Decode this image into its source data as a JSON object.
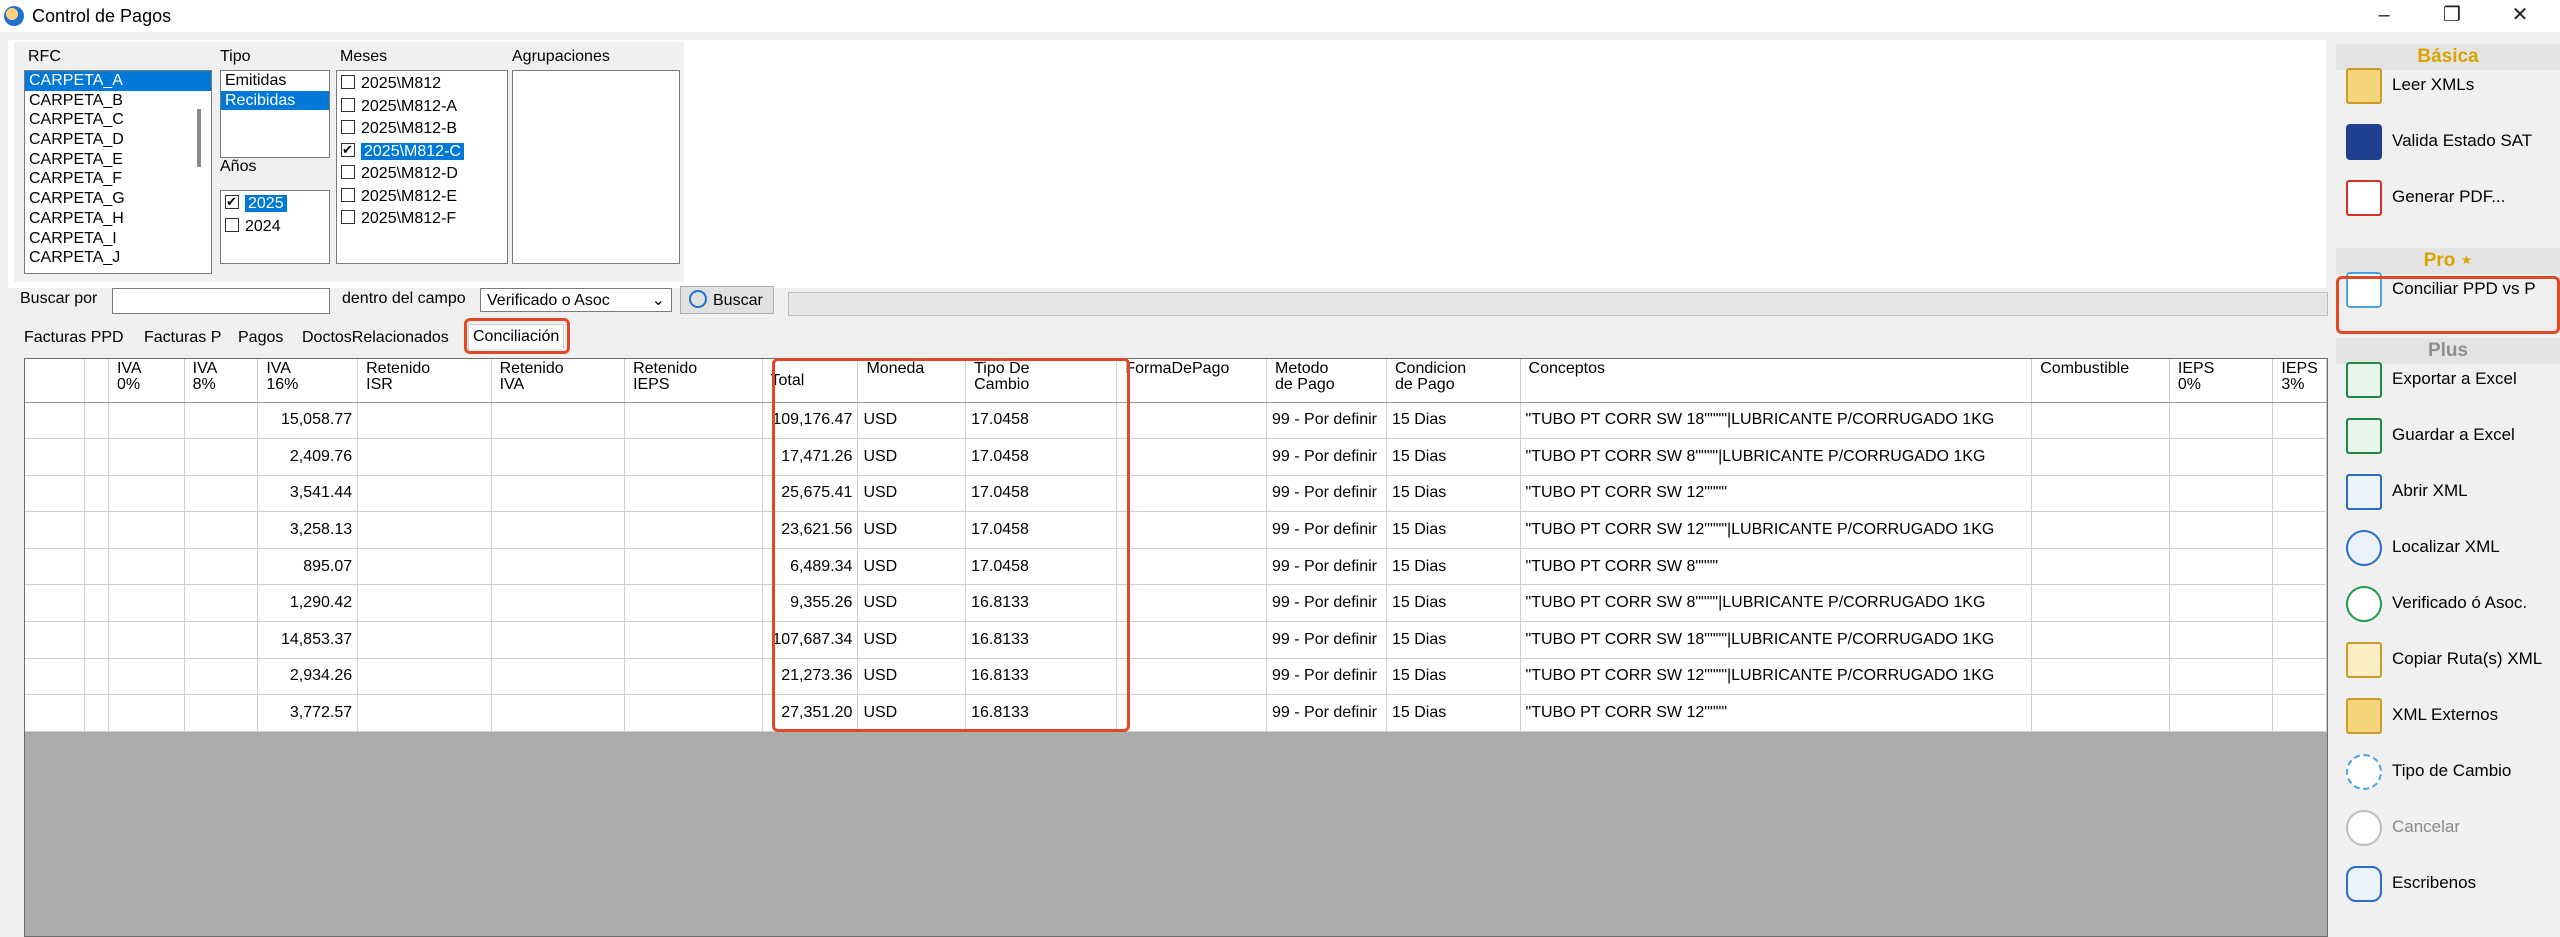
{
  "window": {
    "title": "Control de Pagos"
  },
  "filters": {
    "rfc": {
      "label": "RFC",
      "items": [
        "CARPETA_A",
        "CARPETA_B",
        "CARPETA_C",
        "CARPETA_D",
        "CARPETA_E",
        "CARPETA_F",
        "CARPETA_G",
        "CARPETA_H",
        "CARPETA_I",
        "CARPETA_J"
      ],
      "selected": "CARPETA_A"
    },
    "tipo": {
      "label": "Tipo",
      "items": [
        "Emitidas",
        "Recibidas"
      ],
      "selected": "Recibidas"
    },
    "anios": {
      "label": "Años",
      "items": [
        {
          "label": "2025",
          "checked": true
        },
        {
          "label": "2024",
          "checked": false
        }
      ]
    },
    "meses": {
      "label": "Meses",
      "items": [
        {
          "label": "2025\\M812",
          "checked": false
        },
        {
          "label": "2025\\M812-A",
          "checked": false
        },
        {
          "label": "2025\\M812-B",
          "checked": false
        },
        {
          "label": "2025\\M812-C",
          "checked": true
        },
        {
          "label": "2025\\M812-D",
          "checked": false
        },
        {
          "label": "2025\\M812-E",
          "checked": false
        },
        {
          "label": "2025\\M812-F",
          "checked": false
        }
      ]
    },
    "agrupaciones": {
      "label": "Agrupaciones"
    }
  },
  "search": {
    "label": "Buscar por",
    "value": "",
    "field_label": "dentro del campo",
    "field_value": "Verificado o Asoc",
    "button": "Buscar"
  },
  "tabs": [
    "Facturas PPD",
    "Facturas P",
    "Pagos",
    "DoctosRelacionados",
    "Conciliación"
  ],
  "active_tab": "Conciliación",
  "grid": {
    "columns": [
      "",
      "",
      "IVA\n0%",
      "IVA\n8%",
      "IVA\n16%",
      "Retenido\nISR",
      "Retenido\nIVA",
      "Retenido\nIEPS",
      "Total",
      "Moneda",
      "Tipo De\nCambio",
      "FormaDePago",
      "Metodo\nde Pago",
      "Condicion\nde Pago",
      "Conceptos",
      "Combustible",
      "IEPS\n0%",
      "IEPS\n3%"
    ],
    "rows": [
      {
        "iva16": "15,058.77",
        "total": "109,176.47",
        "moneda": "USD",
        "tc": "17.0458",
        "metodo": "99 - Por definir",
        "condicion": "15 Dias",
        "conceptos": "\"TUBO PT CORR  SW 18\"\"\"\"|LUBRICANTE P/CORRUGADO 1KG"
      },
      {
        "iva16": "2,409.76",
        "total": "17,471.26",
        "moneda": "USD",
        "tc": "17.0458",
        "metodo": "99 - Por definir",
        "condicion": "15 Dias",
        "conceptos": "\"TUBO PT CORR  SW 8\"\"\"\"|LUBRICANTE P/CORRUGADO 1KG"
      },
      {
        "iva16": "3,541.44",
        "total": "25,675.41",
        "moneda": "USD",
        "tc": "17.0458",
        "metodo": "99 - Por definir",
        "condicion": "15 Dias",
        "conceptos": "\"TUBO PT CORR  SW 12\"\"\"\""
      },
      {
        "iva16": "3,258.13",
        "total": "23,621.56",
        "moneda": "USD",
        "tc": "17.0458",
        "metodo": "99 - Por definir",
        "condicion": "15 Dias",
        "conceptos": "\"TUBO PT CORR  SW 12\"\"\"\"|LUBRICANTE P/CORRUGADO 1KG"
      },
      {
        "iva16": "895.07",
        "total": "6,489.34",
        "moneda": "USD",
        "tc": "17.0458",
        "metodo": "99 - Por definir",
        "condicion": "15 Dias",
        "conceptos": "\"TUBO PT CORR  SW 8\"\"\"\""
      },
      {
        "iva16": "1,290.42",
        "total": "9,355.26",
        "moneda": "USD",
        "tc": "16.8133",
        "metodo": "99 - Por definir",
        "condicion": "15 Dias",
        "conceptos": "\"TUBO PT CORR  SW 8\"\"\"\"|LUBRICANTE P/CORRUGADO 1KG"
      },
      {
        "iva16": "14,853.37",
        "total": "107,687.34",
        "moneda": "USD",
        "tc": "16.8133",
        "metodo": "99 - Por definir",
        "condicion": "15 Dias",
        "conceptos": "\"TUBO PT CORR  SW 18\"\"\"\"|LUBRICANTE P/CORRUGADO 1KG"
      },
      {
        "iva16": "2,934.26",
        "total": "21,273.36",
        "moneda": "USD",
        "tc": "16.8133",
        "metodo": "99 - Por definir",
        "condicion": "15 Dias",
        "conceptos": "\"TUBO PT CORR  SW 12\"\"\"\"|LUBRICANTE P/CORRUGADO 1KG"
      },
      {
        "iva16": "3,772.57",
        "total": "27,351.20",
        "moneda": "USD",
        "tc": "16.8133",
        "metodo": "99 - Por definir",
        "condicion": "15 Dias",
        "conceptos": "\"TUBO PT CORR  SW 12\"\"\"\""
      }
    ]
  },
  "panel": {
    "sections": {
      "basica": "Básica",
      "pro": "Pro ⋆",
      "plus": "Plus"
    },
    "buttons": [
      {
        "label": "Leer XMLs",
        "icon": "folder-search-icon"
      },
      {
        "label": "Valida Estado SAT",
        "icon": "sat-icon"
      },
      {
        "label": "Generar PDF...",
        "icon": "pdf-icon"
      },
      {
        "label": "Conciliar PPD vs P",
        "icon": "list-icon"
      },
      {
        "label": "Exportar a Excel",
        "icon": "excel-export-icon"
      },
      {
        "label": "Guardar a Excel",
        "icon": "excel-save-icon"
      },
      {
        "label": "Abrir XML",
        "icon": "xml-open-icon"
      },
      {
        "label": "Localizar  XML",
        "icon": "xml-search-icon"
      },
      {
        "label": "Verificado ó Asoc.",
        "icon": "check-circle-icon"
      },
      {
        "label": "Copiar Ruta(s) XML",
        "icon": "xml-copy-icon"
      },
      {
        "label": "XML Externos",
        "icon": "folder-search-icon"
      },
      {
        "label": "Tipo de Cambio",
        "icon": "exchange-icon"
      },
      {
        "label": "Cancelar",
        "icon": "cancel-icon"
      },
      {
        "label": "Escribenos",
        "icon": "chat-icon"
      }
    ]
  },
  "colors": {
    "accent": "#0078d7",
    "highlight": "#e04826",
    "section_gold": "#d9a400",
    "excel_green": "#1e8a3f",
    "pdf_red": "#d93025"
  }
}
